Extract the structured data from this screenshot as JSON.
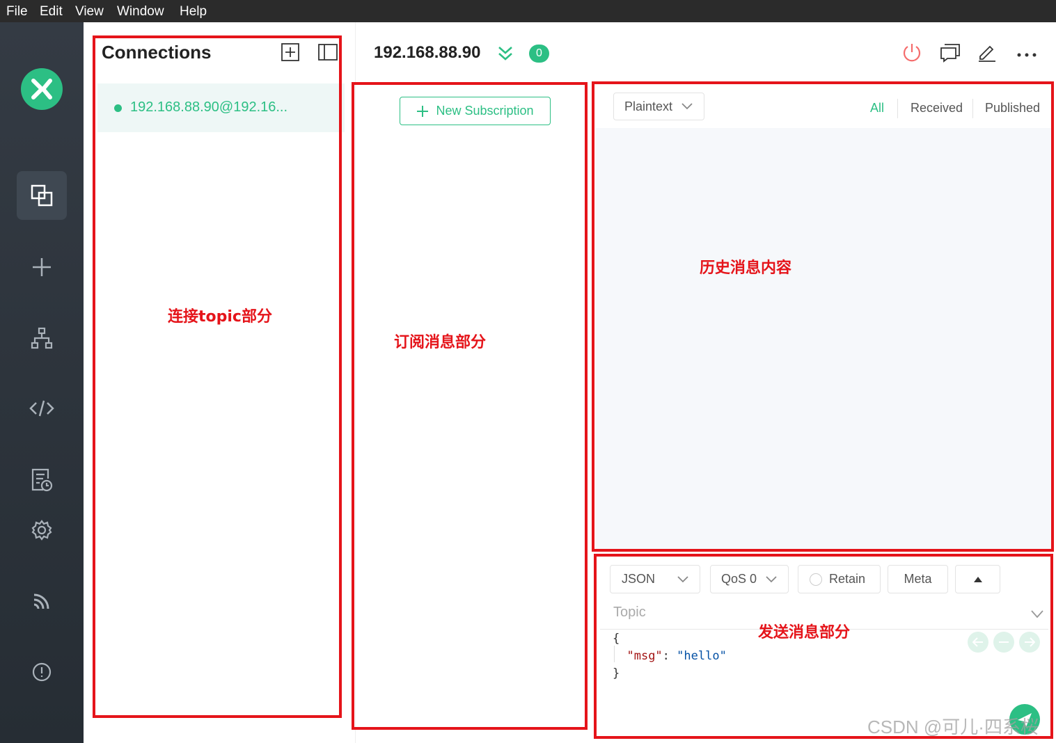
{
  "menu": [
    "File",
    "Edit",
    "View",
    "Window",
    "Help"
  ],
  "connections": {
    "title": "Connections",
    "items": [
      {
        "label": "192.168.88.90@192.16..."
      }
    ]
  },
  "header": {
    "title": "192.168.88.90",
    "count": "0"
  },
  "subscriptions": {
    "new_label": "New Subscription"
  },
  "history": {
    "format": "Plaintext",
    "filters": [
      "All",
      "Received",
      "Published"
    ]
  },
  "publish": {
    "format": "JSON",
    "qos": "QoS 0",
    "retain": "Retain",
    "meta": "Meta",
    "topic_placeholder": "Topic",
    "code_lines": [
      "{",
      "\"msg\"",
      "\"hello\"",
      "}"
    ]
  },
  "annotations": {
    "connections": "连接topic部分",
    "subscriptions": "订阅消息部分",
    "history": "历史消息内容",
    "publish": "发送消息部分"
  },
  "watermark": "CSDN @可儿·四系桜",
  "colors": {
    "accent": "#2cbf84",
    "annotation": "#e5141a",
    "sidebar": "#2f363e"
  }
}
